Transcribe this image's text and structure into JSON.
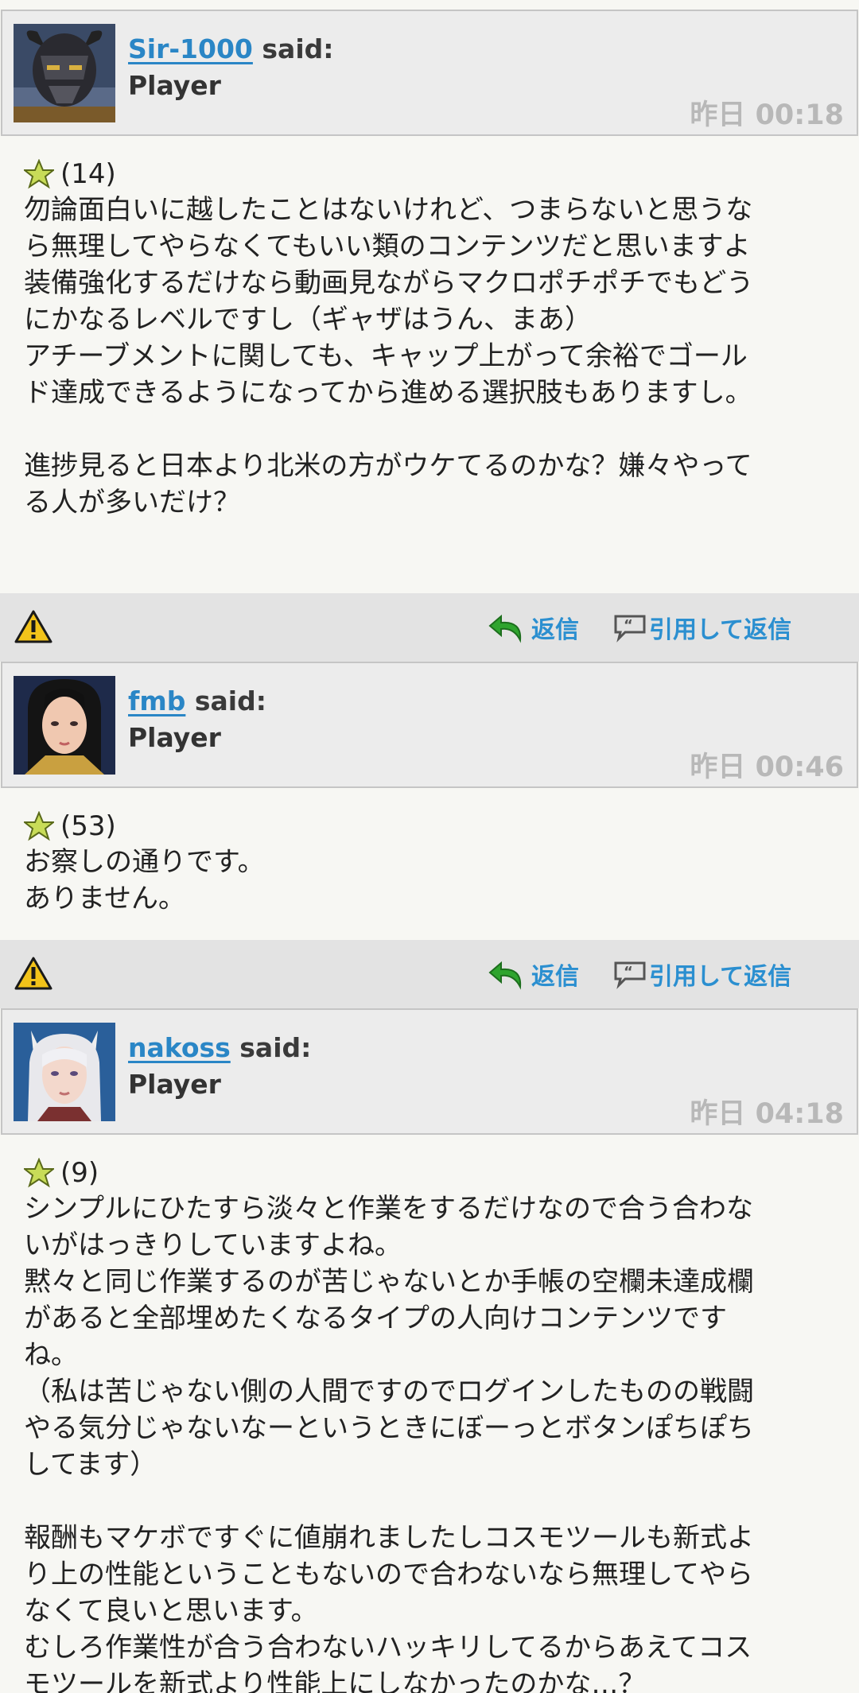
{
  "posts": [
    {
      "author": "Sir-1000",
      "said": "said:",
      "role": "Player",
      "time": "昨日 00:18",
      "rating": "(14)",
      "lines": [
        "勿論面白いに越したことはないけれど、つまらないと思うな",
        "ら無理してやらなくてもいい類のコンテンツだと思いますよ",
        "装備強化するだけなら動画見ながらマクロポチポチでもどう",
        "にかなるレベルですし（ギャザはうん、まあ）",
        "アチーブメントに関しても、キャップ上がって余裕でゴール",
        "ド達成できるようになってから進める選択肢もありますし。",
        "",
        "進捗見ると日本より北米の方がウケてるのかな？嫌々やって",
        "る人が多いだけ？"
      ]
    },
    {
      "author": "fmb",
      "said": "said:",
      "role": "Player",
      "time": "昨日 00:46",
      "rating": "(53)",
      "lines": [
        "お察しの通りです。",
        "ありません。"
      ]
    },
    {
      "author": "nakoss",
      "said": "said:",
      "role": "Player",
      "time": "昨日 04:18",
      "rating": "(9)",
      "lines": [
        "シンプルにひたすら淡々と作業をするだけなので合う合わな",
        "いがはっきりしていますよね。",
        "黙々と同じ作業するのが苦じゃないとか手帳の空欄未達成欄",
        "があると全部埋めたくなるタイプの人向けコンテンツです",
        "ね。",
        "（私は苦じゃない側の人間ですのでログインしたものの戦闘",
        "やる気分じゃないなーというときにぼーっとボタンぽちぽち",
        "してます）",
        "",
        "報酬もマケボですぐに値崩れましたしコスモツールも新式よ",
        "り上の性能ということもないので合わないなら無理してやら",
        "なくて良いと思います。",
        "むしろ作業性が合う合わないハッキリしてるからあえてコス",
        "モツールを新式より性能上にしなかったのかな…？"
      ]
    }
  ],
  "actions": {
    "reply_label": "返信",
    "quote_label": "引用して返信"
  },
  "icons": {
    "rating": "star-icon",
    "report": "warning-icon",
    "reply": "reply-arrow-icon",
    "quote": "quote-icon"
  },
  "colors": {
    "link": "#2a86c6",
    "action": "#2b8fd0",
    "timestamp": "#b8b8b8"
  }
}
